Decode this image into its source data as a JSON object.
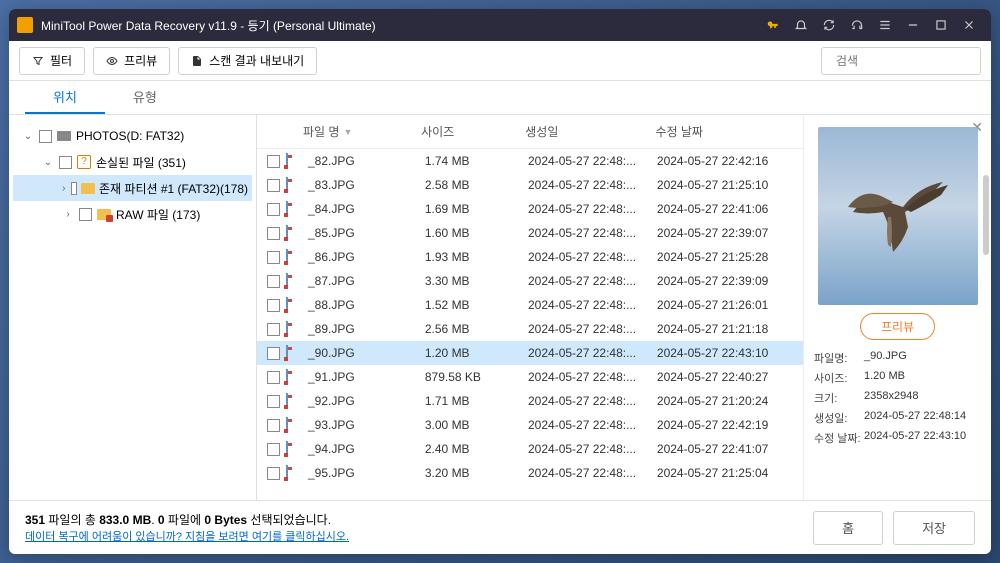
{
  "titlebar": {
    "title": "MiniTool Power Data Recovery v11.9 - 등기 (Personal Ultimate)"
  },
  "toolbar": {
    "filter": "필터",
    "preview": "프리뷰",
    "export": "스캔 결과 내보내기",
    "search_placeholder": "검색"
  },
  "tabs": {
    "location": "위치",
    "type": "유형"
  },
  "tree": {
    "root": "PHOTOS(D: FAT32)",
    "lost": "손실된 파일 (351)",
    "partition": "존재 파티션 #1 (FAT32)(178)",
    "raw": "RAW 파일 (173)"
  },
  "columns": {
    "name": "파일 명",
    "size": "사이즈",
    "created": "생성일",
    "modified": "수정 날짜"
  },
  "files": [
    {
      "name": "_82.JPG",
      "size": "1.74 MB",
      "created": "2024-05-27 22:48:...",
      "modified": "2024-05-27 22:42:16"
    },
    {
      "name": "_83.JPG",
      "size": "2.58 MB",
      "created": "2024-05-27 22:48:...",
      "modified": "2024-05-27 21:25:10"
    },
    {
      "name": "_84.JPG",
      "size": "1.69 MB",
      "created": "2024-05-27 22:48:...",
      "modified": "2024-05-27 22:41:06"
    },
    {
      "name": "_85.JPG",
      "size": "1.60 MB",
      "created": "2024-05-27 22:48:...",
      "modified": "2024-05-27 22:39:07"
    },
    {
      "name": "_86.JPG",
      "size": "1.93 MB",
      "created": "2024-05-27 22:48:...",
      "modified": "2024-05-27 21:25:28"
    },
    {
      "name": "_87.JPG",
      "size": "3.30 MB",
      "created": "2024-05-27 22:48:...",
      "modified": "2024-05-27 22:39:09"
    },
    {
      "name": "_88.JPG",
      "size": "1.52 MB",
      "created": "2024-05-27 22:48:...",
      "modified": "2024-05-27 21:26:01"
    },
    {
      "name": "_89.JPG",
      "size": "2.56 MB",
      "created": "2024-05-27 22:48:...",
      "modified": "2024-05-27 21:21:18"
    },
    {
      "name": "_90.JPG",
      "size": "1.20 MB",
      "created": "2024-05-27 22:48:...",
      "modified": "2024-05-27 22:43:10",
      "selected": true
    },
    {
      "name": "_91.JPG",
      "size": "879.58 KB",
      "created": "2024-05-27 22:48:...",
      "modified": "2024-05-27 22:40:27"
    },
    {
      "name": "_92.JPG",
      "size": "1.71 MB",
      "created": "2024-05-27 22:48:...",
      "modified": "2024-05-27 21:20:24"
    },
    {
      "name": "_93.JPG",
      "size": "3.00 MB",
      "created": "2024-05-27 22:48:...",
      "modified": "2024-05-27 22:42:19"
    },
    {
      "name": "_94.JPG",
      "size": "2.40 MB",
      "created": "2024-05-27 22:48:...",
      "modified": "2024-05-27 22:41:07"
    },
    {
      "name": "_95.JPG",
      "size": "3.20 MB",
      "created": "2024-05-27 22:48:...",
      "modified": "2024-05-27 21:25:04"
    }
  ],
  "preview": {
    "button": "프리뷰",
    "labels": {
      "filename": "파일명:",
      "size": "사이즈:",
      "dims": "크기:",
      "created": "생성일:",
      "modified": "수정 날짜:"
    },
    "filename": "_90.JPG",
    "size": "1.20 MB",
    "dims": "2358x2948",
    "created": "2024-05-27 22:48:14",
    "modified": "2024-05-27 22:43:10"
  },
  "footer": {
    "status_prefix": "351",
    "status_mid": " 파일의 총 ",
    "status_size": "833.0 MB",
    "status_sep": ".  ",
    "status_sel_count": "0",
    "status_sel_mid": " 파일에 ",
    "status_sel_size": "0 Bytes",
    "status_suffix": " 선택되었습니다.",
    "link": "데이터 복구에 어려움이 있습니까? 지침을 보려면 여기를 클릭하십시오.",
    "home": "홈",
    "save": "저장"
  }
}
